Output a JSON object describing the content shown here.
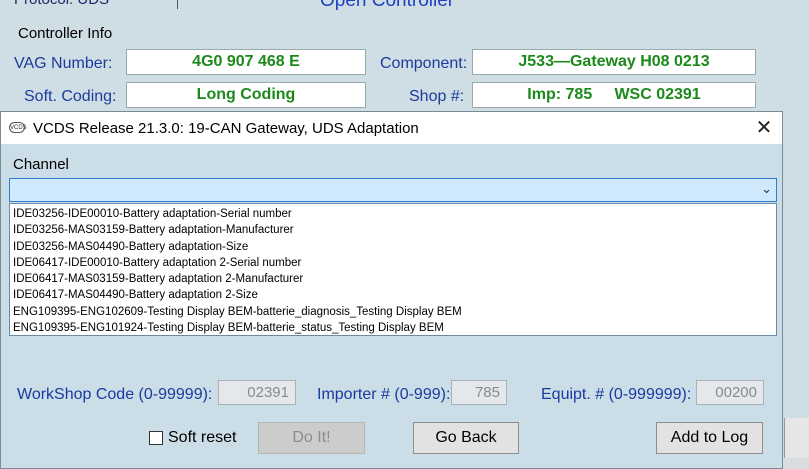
{
  "background": {
    "protocol_text": "Protocol: UDS",
    "open_controller": "Open Controller",
    "controller_info": "Controller Info",
    "vag_label": "VAG Number:",
    "vag_value": "4G0 907 468 E",
    "component_label": "Component:",
    "component_value": "J533—Gateway H08 0213",
    "coding_label": "Soft. Coding:",
    "coding_value": "Long Coding",
    "shop_label": "Shop #:",
    "shop_value": "Imp: 785     WSC 02391"
  },
  "dialog": {
    "icon_text": "VCDS",
    "title": "VCDS Release 21.3.0: 19-CAN Gateway,  UDS Adaptation",
    "close": "✕",
    "channel_label": "Channel",
    "channel_value": "",
    "chevron": "⌄",
    "channel_options": [
      "IDE03256-IDE00010-Battery adaptation-Serial number",
      "IDE03256-MAS03159-Battery adaptation-Manufacturer",
      "IDE03256-MAS04490-Battery adaptation-Size",
      "IDE06417-IDE00010-Battery adaptation 2-Serial number",
      "IDE06417-MAS03159-Battery adaptation 2-Manufacturer",
      "IDE06417-MAS04490-Battery adaptation 2-Size",
      "ENG109395-ENG102609-Testing Display BEM-batterie_diagnosis_Testing Display BEM",
      "ENG109395-ENG101924-Testing Display BEM-batterie_status_Testing Display BEM"
    ],
    "workshop_label": "WorkShop Code (0-99999):",
    "workshop_value": "02391",
    "importer_label": "Importer # (0-999):",
    "importer_value": "785",
    "equipt_label": "Equipt. # (0-999999):",
    "equipt_value": "00200",
    "soft_reset_label": "Soft reset",
    "do_it_label": "Do It!",
    "go_back_label": "Go Back",
    "add_to_log_label": "Add to Log"
  }
}
